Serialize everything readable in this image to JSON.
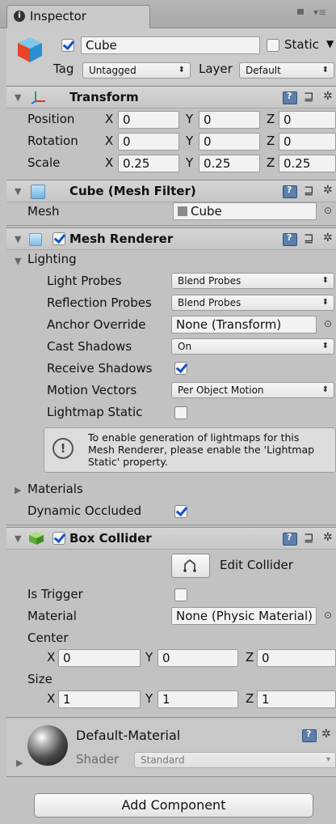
{
  "tab": {
    "title": "Inspector",
    "icon": "info-icon"
  },
  "object": {
    "name": "Cube",
    "static_label": "Static",
    "tag_label": "Tag",
    "tag_value": "Untagged",
    "layer_label": "Layer",
    "layer_value": "Default",
    "active": true
  },
  "transform": {
    "title": "Transform",
    "rows": [
      {
        "label": "Position",
        "x": "0",
        "y": "0",
        "z": "0"
      },
      {
        "label": "Rotation",
        "x": "0",
        "y": "0",
        "z": "0"
      },
      {
        "label": "Scale",
        "x": "0.25",
        "y": "0.25",
        "z": "0.25"
      }
    ],
    "axis": {
      "x": "X",
      "y": "Y",
      "z": "Z"
    }
  },
  "mesh_filter": {
    "title": "Cube (Mesh Filter)",
    "mesh_label": "Mesh",
    "mesh_value": "Cube"
  },
  "mesh_renderer": {
    "title": "Mesh Renderer",
    "lighting_label": "Lighting",
    "light_probes_label": "Light Probes",
    "light_probes_value": "Blend Probes",
    "reflection_probes_label": "Reflection Probes",
    "reflection_probes_value": "Blend Probes",
    "anchor_label": "Anchor Override",
    "anchor_value": "None (Transform)",
    "cast_shadows_label": "Cast Shadows",
    "cast_shadows_value": "On",
    "receive_shadows_label": "Receive Shadows",
    "receive_shadows": true,
    "motion_vectors_label": "Motion Vectors",
    "motion_vectors_value": "Per Object Motion",
    "lightmap_static_label": "Lightmap Static",
    "lightmap_static": false,
    "info_lines": [
      "To enable generation of lightmaps for this",
      "Mesh Renderer, please enable the 'Lightmap",
      "Static' property."
    ],
    "materials_label": "Materials",
    "dynamic_occluded_label": "Dynamic Occluded",
    "dynamic_occluded": true
  },
  "box_collider": {
    "title": "Box Collider",
    "edit_label": "Edit Collider",
    "is_trigger_label": "Is Trigger",
    "is_trigger": false,
    "material_label": "Material",
    "material_value": "None (Physic Material)",
    "center_label": "Center",
    "center": {
      "x": "0",
      "y": "0",
      "z": "0"
    },
    "size_label": "Size",
    "size": {
      "x": "1",
      "y": "1",
      "z": "1"
    }
  },
  "material": {
    "name": "Default-Material",
    "shader_label": "Shader",
    "shader_value": "Standard"
  },
  "add_component_label": "Add Component",
  "colors": {
    "accent": "#1553c7",
    "panel": "#c2c2c2",
    "header": "#cbcbcb"
  }
}
